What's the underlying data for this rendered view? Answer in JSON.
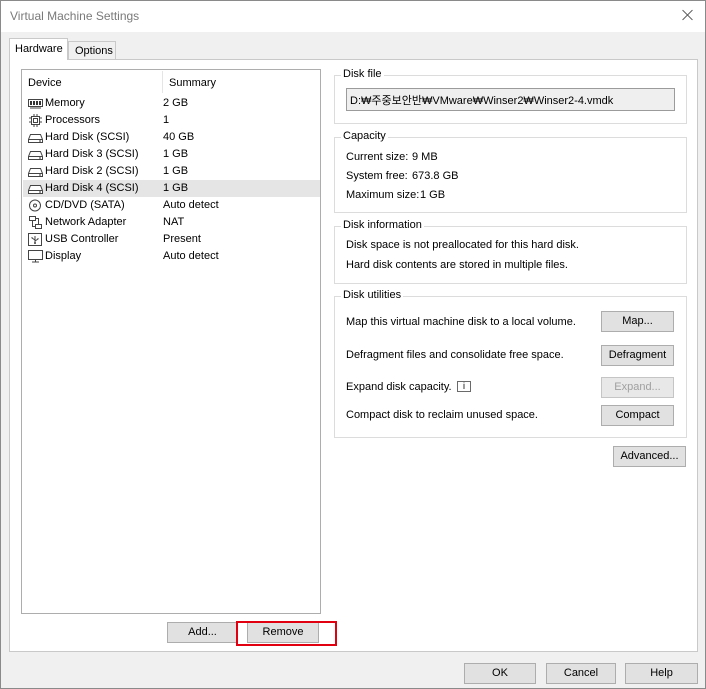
{
  "window": {
    "title": "Virtual Machine Settings"
  },
  "tabs": [
    {
      "label": "Hardware"
    },
    {
      "label": "Options"
    }
  ],
  "device_list": {
    "headers": {
      "device": "Device",
      "summary": "Summary"
    },
    "rows": [
      {
        "device": "Memory",
        "summary": "2 GB",
        "icon": "memory-icon"
      },
      {
        "device": "Processors",
        "summary": "1",
        "icon": "processor-icon"
      },
      {
        "device": "Hard Disk (SCSI)",
        "summary": "40 GB",
        "icon": "hard-disk-icon"
      },
      {
        "device": "Hard Disk 3 (SCSI)",
        "summary": "1 GB",
        "icon": "hard-disk-icon"
      },
      {
        "device": "Hard Disk 2 (SCSI)",
        "summary": "1 GB",
        "icon": "hard-disk-icon"
      },
      {
        "device": "Hard Disk 4 (SCSI)",
        "summary": "1 GB",
        "icon": "hard-disk-icon",
        "selected": true
      },
      {
        "device": "CD/DVD (SATA)",
        "summary": "Auto detect",
        "icon": "cd-dvd-icon"
      },
      {
        "device": "Network Adapter",
        "summary": "NAT",
        "icon": "network-adapter-icon"
      },
      {
        "device": "USB Controller",
        "summary": "Present",
        "icon": "usb-icon"
      },
      {
        "device": "Display",
        "summary": "Auto detect",
        "icon": "display-icon"
      }
    ]
  },
  "buttons": {
    "add": "Add...",
    "remove": "Remove",
    "ok": "OK",
    "cancel": "Cancel",
    "help": "Help",
    "advanced": "Advanced..."
  },
  "disk_file": {
    "label": "Disk file",
    "path": "D:₩주중보안반₩VMware₩Winser2₩Winser2-4.vmdk"
  },
  "capacity": {
    "label": "Capacity",
    "current_size": {
      "label": "Current size:",
      "value": "9 MB"
    },
    "system_free": {
      "label": "System free:",
      "value": "673.8 GB"
    },
    "maximum_size": {
      "label": "Maximum size:",
      "value": "1 GB"
    }
  },
  "disk_information": {
    "label": "Disk information",
    "line1": "Disk space is not preallocated for this hard disk.",
    "line2": "Hard disk contents are stored in multiple files."
  },
  "disk_utilities": {
    "label": "Disk utilities",
    "map": {
      "text": "Map this virtual machine disk to a local volume.",
      "button": "Map..."
    },
    "defragment": {
      "text": "Defragment files and consolidate free space.",
      "button": "Defragment"
    },
    "expand": {
      "text": "Expand disk capacity.",
      "button": "Expand...",
      "info_icon": "info-icon",
      "disabled": true
    },
    "compact": {
      "text": "Compact disk to reclaim unused space.",
      "button": "Compact"
    }
  },
  "colors": {
    "highlight": "#e0000f",
    "selected_row": "#e5e5e5"
  }
}
